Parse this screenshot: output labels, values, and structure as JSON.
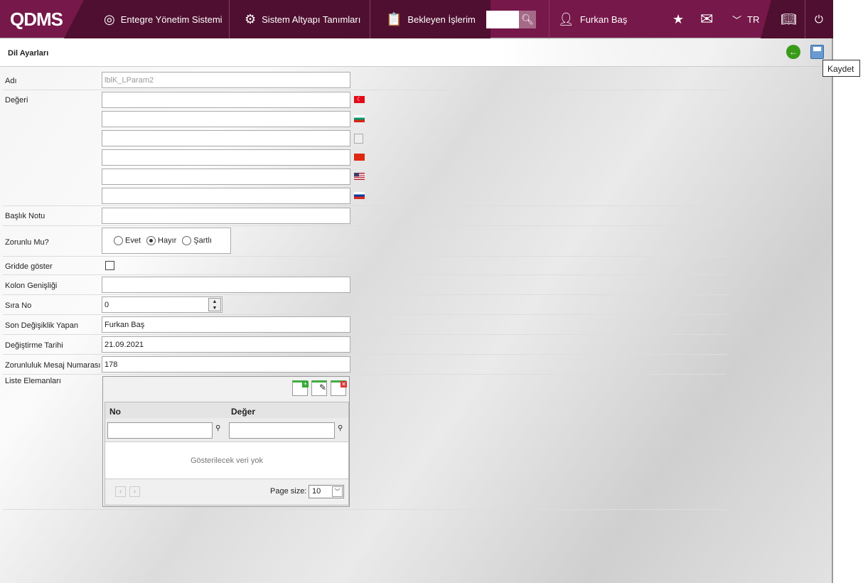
{
  "header": {
    "logo": "QDMS",
    "nav": [
      "Entegre Yönetim Sistemi",
      "Sistem Altyapı Tanımları",
      "Bekleyen İşlerim"
    ],
    "user": "Furkan Baş",
    "lang": "TR",
    "search_value": ""
  },
  "page": {
    "title": "Dil Ayarları",
    "tooltip": "Kaydet"
  },
  "form": {
    "adi_label": "Adı",
    "adi_value": "lblK_LParam2",
    "degeri_label": "Değeri",
    "baslik_label": "Başlık Notu",
    "zorunlu_label": "Zorunlu Mu?",
    "options": [
      "Evet",
      "Hayır",
      "Şartlı"
    ],
    "selected": "Hayır",
    "gridde_label": "Gridde göster",
    "gridde_checked": false,
    "kolon_label": "Kolon Genişliği",
    "sira_label": "Sıra No",
    "sira_value": "0",
    "son_label": "Son Değişiklik Yapan",
    "son_value": "Furkan Baş",
    "tarih_label": "Değiştirme Tarihi",
    "tarih_value": "21.09.2021",
    "mesaj_label": "Zorunluluk Mesaj Numarası",
    "mesaj_value": "178",
    "liste_label": "Liste Elemanları"
  },
  "grid": {
    "columns": [
      "No",
      "Değer"
    ],
    "empty": "Gösterilecek veri yok",
    "page_size_label": "Page size:",
    "page_size": "10"
  },
  "colors": {
    "brand": "#76184a",
    "brand_dark": "#4f0f30"
  }
}
